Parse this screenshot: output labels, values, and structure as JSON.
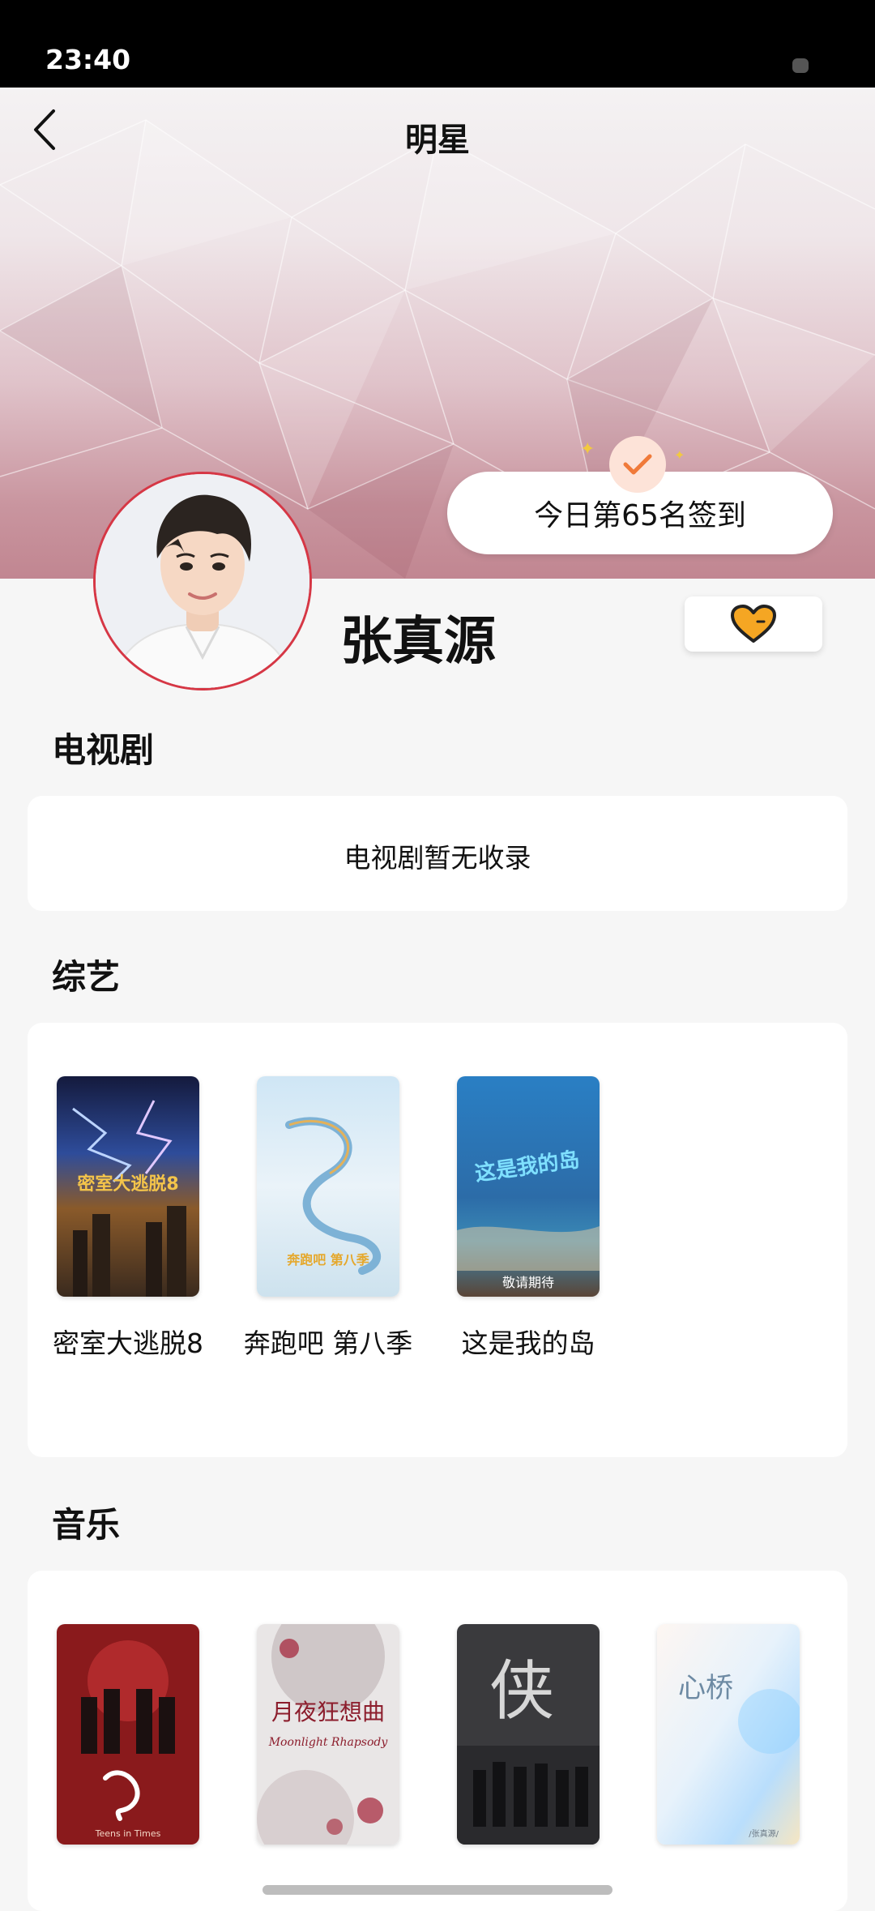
{
  "status_bar": {
    "time": "23:40"
  },
  "header": {
    "title": "明星"
  },
  "checkin": {
    "text": "今日第65名签到"
  },
  "profile": {
    "name": "张真源"
  },
  "sections": {
    "tv": {
      "title": "电视剧",
      "empty_text": "电视剧暂无收录"
    },
    "variety": {
      "title": "综艺",
      "items": [
        {
          "label": "密室大逃脱8",
          "poster_text": "密室大逃脱8"
        },
        {
          "label": "奔跑吧 第八季",
          "poster_text": "奔跑吧 第八季"
        },
        {
          "label": "这是我的岛",
          "poster_text": "这是我的岛",
          "poster_sub": "敬请期待"
        }
      ]
    },
    "music": {
      "title": "音乐",
      "items": [
        {
          "poster_text": "Teens in Times"
        },
        {
          "poster_text": "月夜狂想曲",
          "poster_sub": "Moonlight Rhapsody"
        },
        {
          "poster_text": "侠"
        },
        {
          "poster_text": "心桥",
          "poster_sub": "/张真源/"
        }
      ]
    }
  },
  "colors": {
    "accent_red": "#d63745",
    "heart_orange": "#f5a623",
    "check_orange": "#f07a3a"
  }
}
